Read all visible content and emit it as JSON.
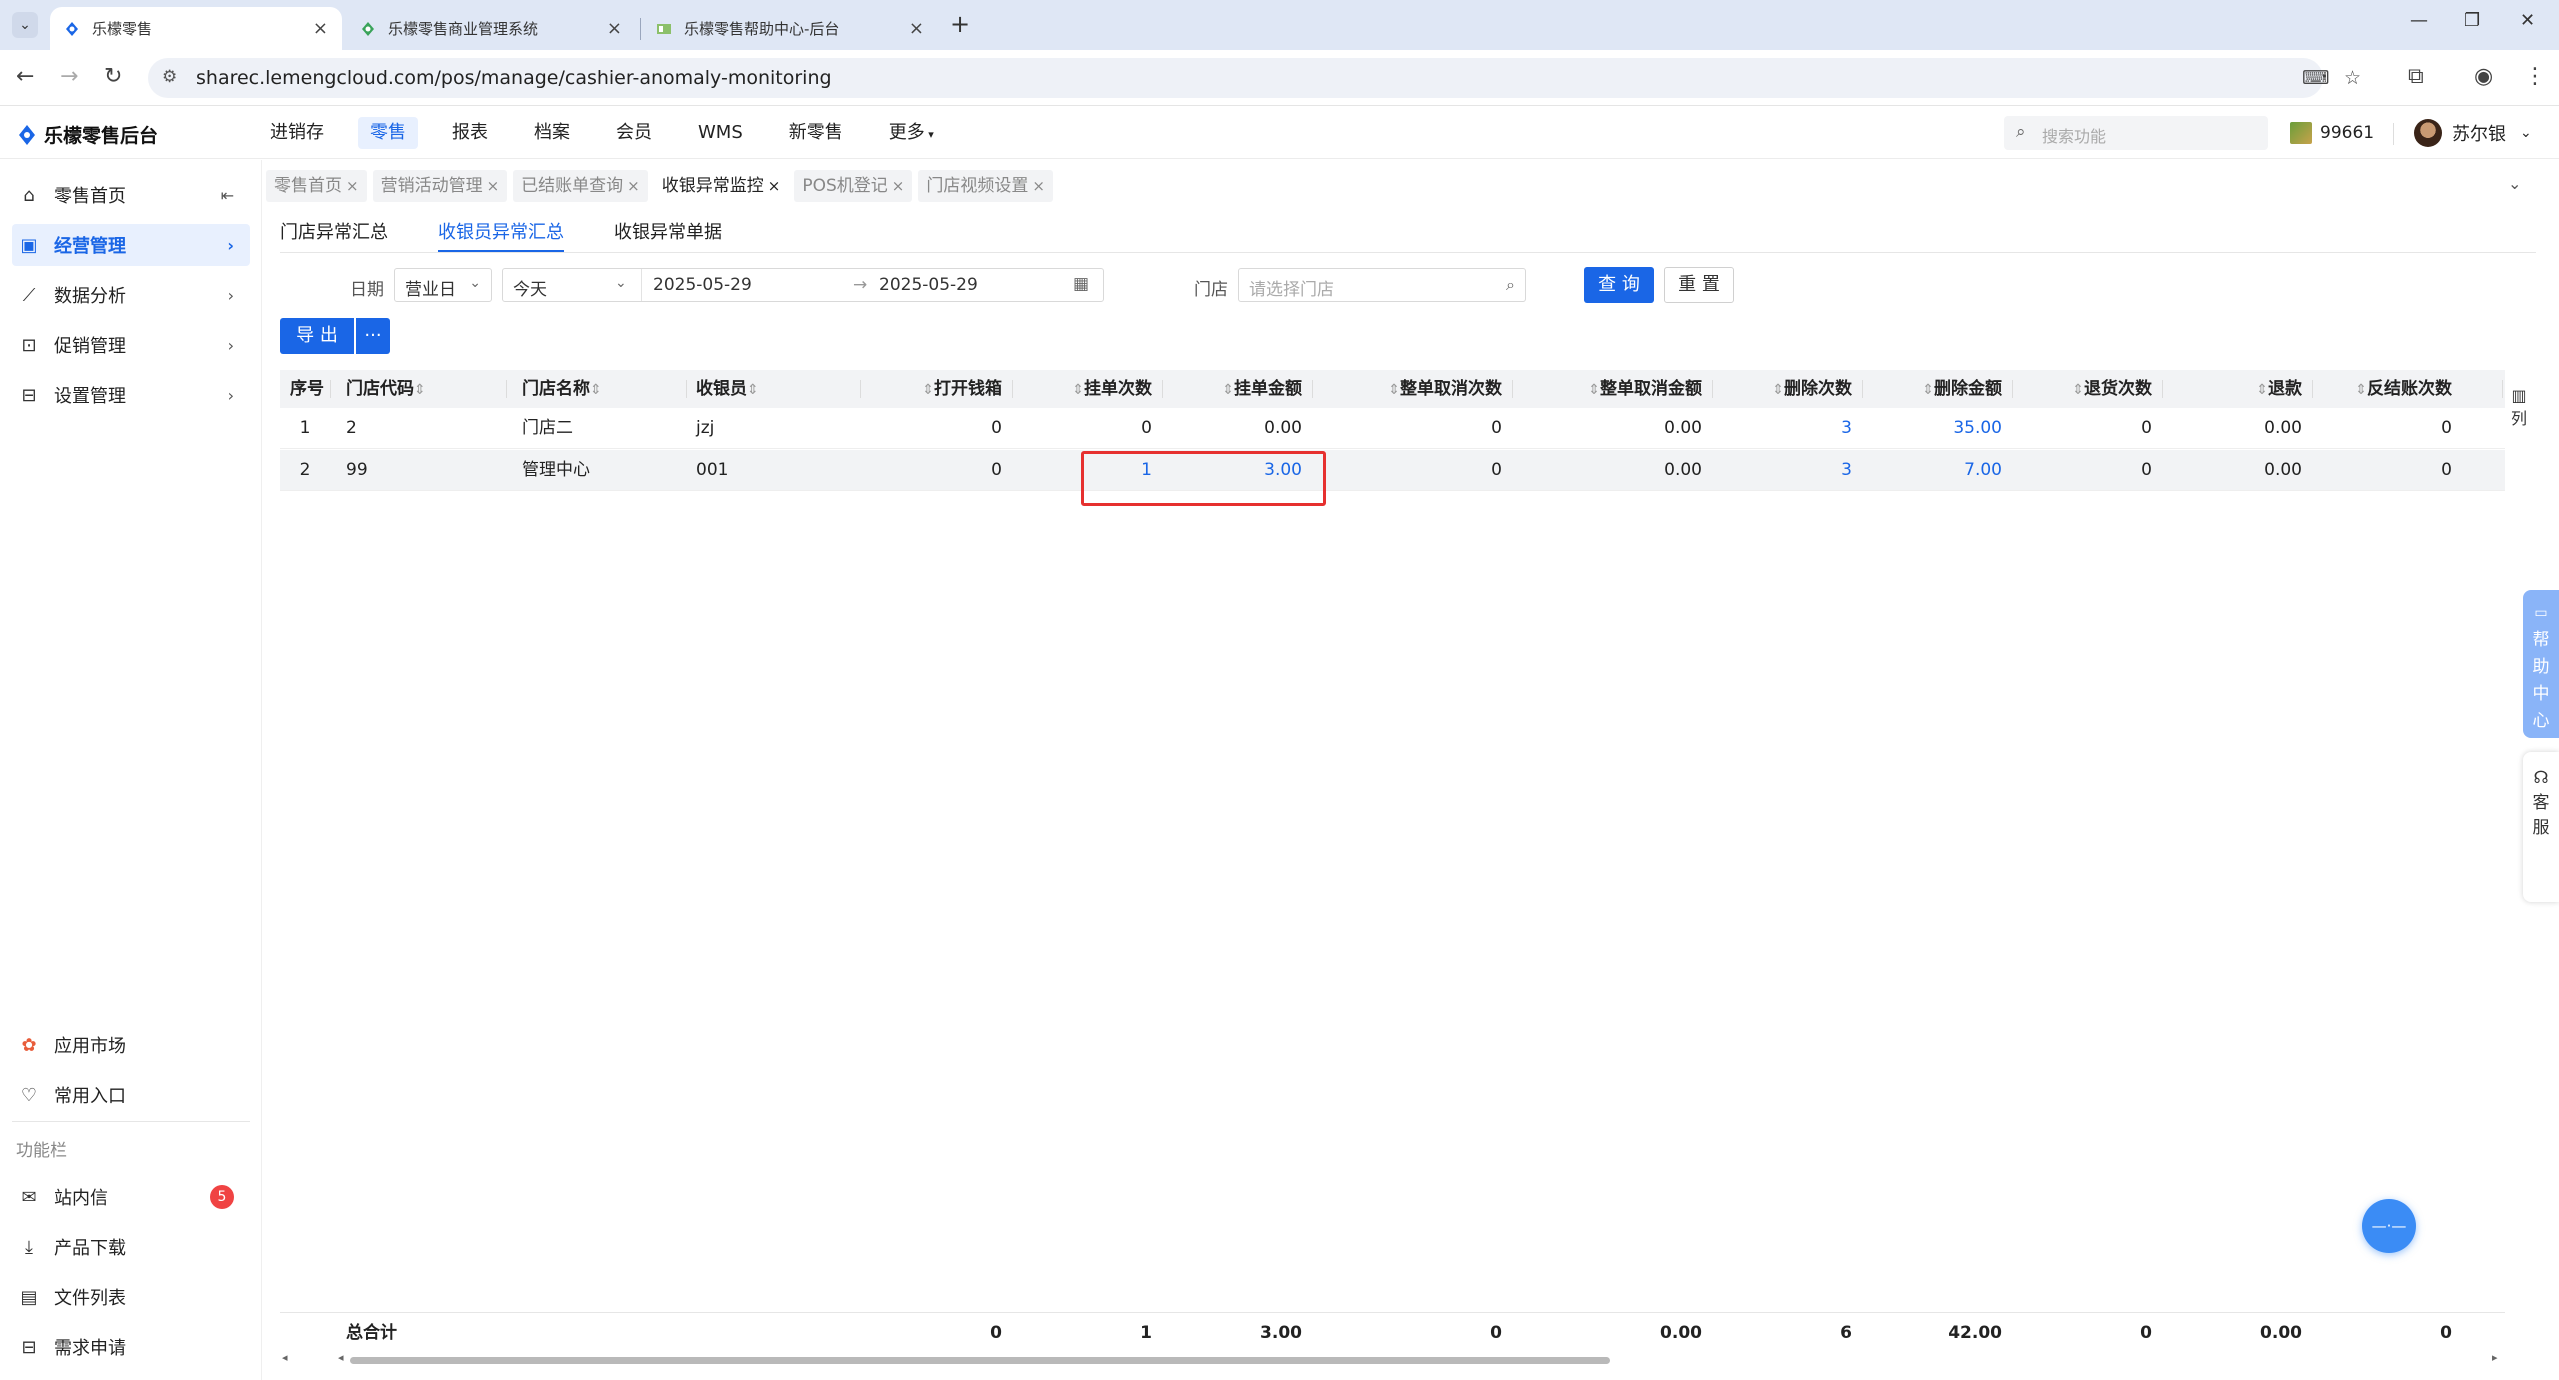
{
  "browser": {
    "tabs": [
      {
        "title": "乐檬零售",
        "active": true
      },
      {
        "title": "乐檬零售商业管理系统",
        "active": false
      },
      {
        "title": "乐檬零售帮助中心-后台",
        "active": false
      }
    ],
    "url": "sharec.lemengcloud.com/pos/manage/cashier-anomaly-monitoring"
  },
  "app": {
    "logo": "乐檬零售后台",
    "menu": [
      "进销存",
      "零售",
      "报表",
      "档案",
      "会员",
      "WMS",
      "新零售",
      "更多"
    ],
    "active_menu": "零售",
    "search_placeholder": "搜索功能",
    "coins": "99661",
    "user": "苏尔银"
  },
  "sidebar": {
    "items": [
      {
        "label": "零售首页",
        "icon": "home-icon"
      },
      {
        "label": "经营管理",
        "icon": "monitor-icon",
        "active": true
      },
      {
        "label": "数据分析",
        "icon": "chart-line-icon"
      },
      {
        "label": "促销管理",
        "icon": "promotion-icon"
      },
      {
        "label": "设置管理",
        "icon": "settings-icon"
      }
    ],
    "bottom": [
      {
        "label": "应用市场",
        "icon": "app-market-icon"
      },
      {
        "label": "常用入口",
        "icon": "heart-icon"
      }
    ],
    "section_title": "功能栏",
    "tools": [
      {
        "label": "站内信",
        "icon": "mail-icon",
        "badge": "5"
      },
      {
        "label": "产品下载",
        "icon": "download-icon"
      },
      {
        "label": "文件列表",
        "icon": "file-list-icon"
      },
      {
        "label": "需求申请",
        "icon": "request-icon"
      }
    ]
  },
  "page_tabs": [
    {
      "label": "零售首页"
    },
    {
      "label": "营销活动管理"
    },
    {
      "label": "已结账单查询"
    },
    {
      "label": "收银异常监控",
      "active": true
    },
    {
      "label": "POS机登记"
    },
    {
      "label": "门店视频设置"
    }
  ],
  "sub_tabs": [
    {
      "label": "门店异常汇总"
    },
    {
      "label": "收银员异常汇总",
      "active": true
    },
    {
      "label": "收银异常单据"
    }
  ],
  "filters": {
    "date_label": "日期",
    "date_type": "营业日",
    "range_preset": "今天",
    "start_date": "2025-05-29",
    "range_sep": "→",
    "end_date": "2025-05-29",
    "store_label": "门店",
    "store_placeholder": "请选择门店",
    "query_btn": "查 询",
    "reset_btn": "重 置",
    "export_btn": "导 出",
    "more_btn": "···"
  },
  "table": {
    "columns": [
      "序号",
      "门店代码",
      "门店名称",
      "收银员",
      "打开钱箱",
      "挂单次数",
      "挂单金额",
      "整单取消次数",
      "整单取消金额",
      "删除次数",
      "删除金额",
      "退货次数",
      "退款",
      "反结账次数"
    ],
    "rows": [
      [
        "1",
        "2",
        "门店二",
        "jzj",
        "0",
        "0",
        "0.00",
        "0",
        "0.00",
        "3",
        "35.00",
        "0",
        "0.00",
        "0"
      ],
      [
        "2",
        "99",
        "管理中心",
        "001",
        "0",
        "1",
        "3.00",
        "0",
        "0.00",
        "3",
        "7.00",
        "0",
        "0.00",
        "0"
      ]
    ],
    "column_settings": "列",
    "footer": {
      "label": "总合计",
      "values": [
        "0",
        "1",
        "3.00",
        "0",
        "0.00",
        "6",
        "42.00",
        "0",
        "0.00",
        "0"
      ]
    }
  },
  "float": {
    "help": "帮助中心",
    "service": "客服"
  }
}
